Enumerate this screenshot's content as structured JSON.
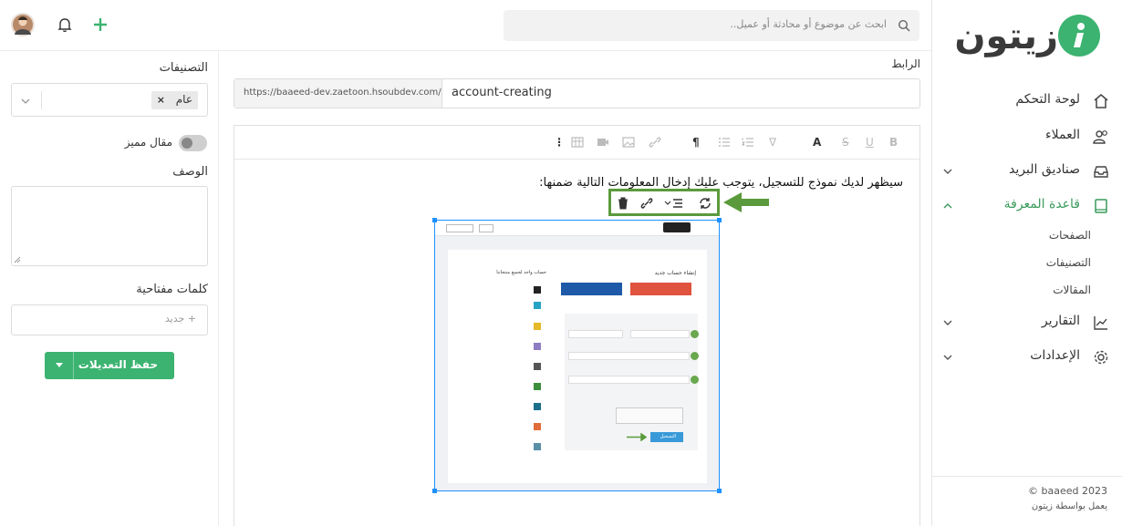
{
  "nav": {
    "logo_text": "زيتون",
    "items": [
      {
        "label": "لوحة التحكم",
        "icon": "home-icon"
      },
      {
        "label": "العملاء",
        "icon": "users-icon"
      },
      {
        "label": "صناديق البريد",
        "icon": "inbox-icon"
      },
      {
        "label": "قاعدة المعرفة",
        "icon": "book-icon"
      },
      {
        "label": "التقارير",
        "icon": "chart-icon"
      },
      {
        "label": "الإعدادات",
        "icon": "gear-icon"
      }
    ],
    "sub_items": [
      "الصفحات",
      "التصنيفات",
      "المقالات"
    ],
    "footer_copyright": "© baaeed 2023",
    "footer_powered": "يعمل بواسطة زيتون"
  },
  "header": {
    "search_placeholder": "ابحث عن موضوع أو محادثة أو عميل.."
  },
  "sidebar": {
    "categories_label": "التصنيفات",
    "category_tag": "عام",
    "featured_label": "مقال مميز",
    "description_label": "الوصف",
    "keywords_label": "كلمات مفتاحية",
    "keywords_placeholder": "+ جديد",
    "save_label": "حفظ التعديلات"
  },
  "main": {
    "link_label": "الرابط",
    "url_prefix": "https://baaeed-dev.zaetoon.hsoubdev.com/",
    "url_slug": "account-creating",
    "content_text": "سيظهر لديك نموذج للتسجيل، يتوجب عليك إدخال المعلومات التالية ضمنها:"
  },
  "embedded_image": {
    "title": "إنشاء حساب جديد",
    "side_title": "حساب واحد لجميع منتجاتنا",
    "submit": "التسجيل"
  },
  "colors": {
    "accent": "#3cb371",
    "highlight": "#5b9a3c",
    "selection": "#1e90ff"
  }
}
